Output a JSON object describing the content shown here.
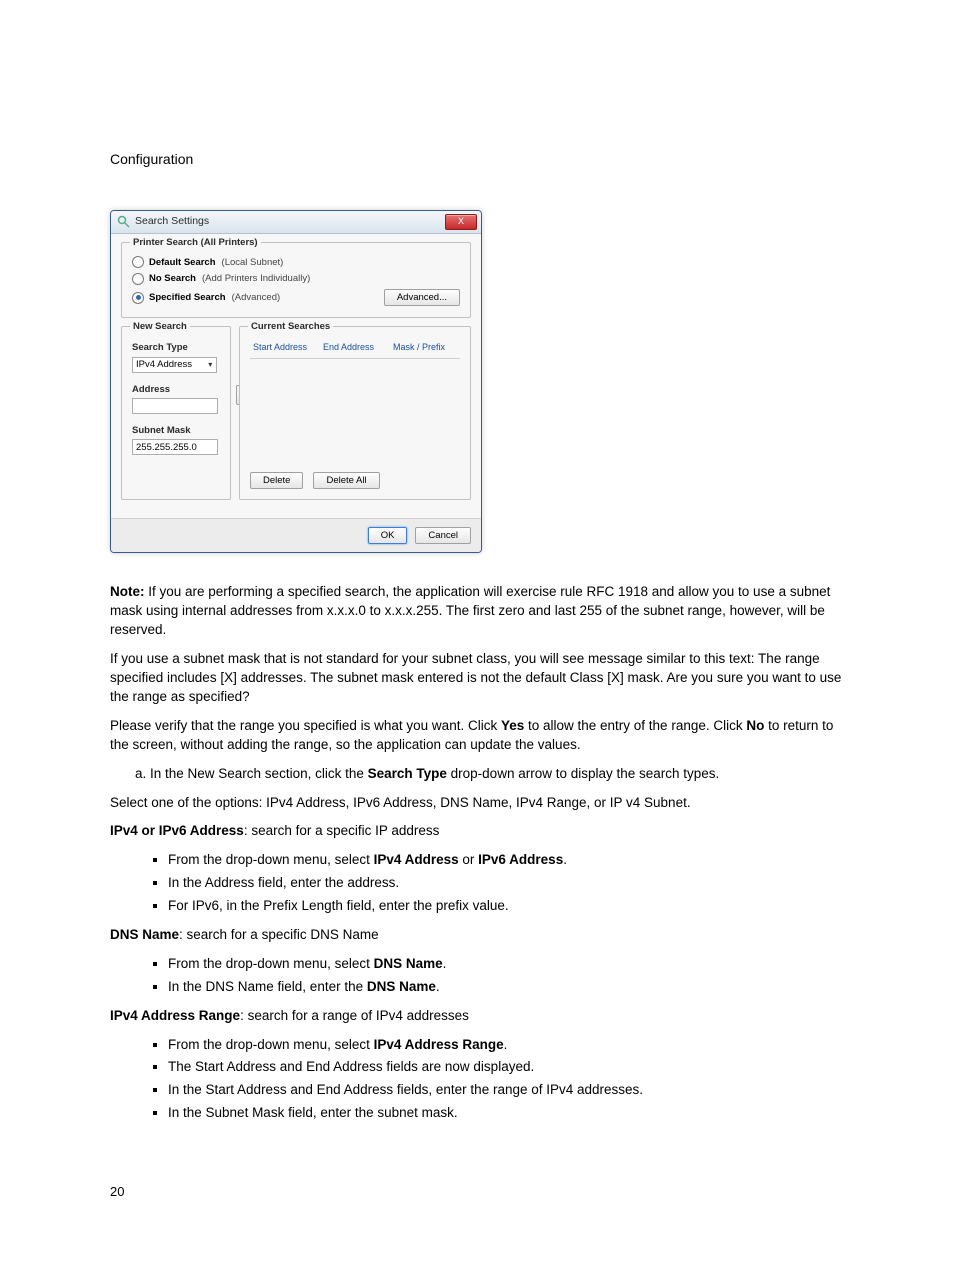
{
  "page": {
    "header": "Configuration",
    "number": "20"
  },
  "dialog": {
    "title": "Search Settings",
    "close": "X",
    "group_printer_search": {
      "legend": "Printer Search (All Printers)",
      "opt1": {
        "label": "Default Search",
        "hint": "(Local Subnet)"
      },
      "opt2": {
        "label": "No Search",
        "hint": "(Add Printers Individually)"
      },
      "opt3": {
        "label": "Specified Search",
        "hint": "(Advanced)"
      },
      "advanced_btn": "Advanced..."
    },
    "new_search": {
      "legend": "New Search",
      "search_type_label": "Search Type",
      "search_type_value": "IPv4 Address",
      "address_label": "Address",
      "address_value": "",
      "subnet_label": "Subnet Mask",
      "subnet_value": "255.255.255.0"
    },
    "current_searches": {
      "legend": "Current Searches",
      "col1": "Start Address",
      "col2": "End Address",
      "col3": "Mask / Prefix",
      "delete_btn": "Delete",
      "delete_all_btn": "Delete All"
    },
    "footer": {
      "ok": "OK",
      "cancel": "Cancel"
    }
  },
  "body": {
    "note_label": "Note:",
    "note_text": " If you are performing a specified search, the application will exercise rule RFC 1918 and allow you to use a subnet mask using internal addresses from x.x.x.0 to x.x.x.255. The first zero and last 255 of the subnet range, however, will be reserved.",
    "p2": "If you use a subnet mask that is not standard for your subnet class, you will see message similar to this text: The range specified includes [X] addresses. The subnet mask entered is not the default Class [X] mask. Are you sure you want to use the range as specified?",
    "p3_a": "Please verify that the range you specified is what you want. Click ",
    "p3_yes": "Yes",
    "p3_b": " to allow the entry of the range. Click ",
    "p3_no": "No",
    "p3_c": " to return to the screen, without adding the range, so the application can update the values.",
    "ol_a_pre": "In the New Search section, click the ",
    "ol_a_bold": "Search Type",
    "ol_a_post": " drop-down arrow to display the search types.",
    "p4": "Select one of the options: IPv4 Address, IPv6 Address, DNS Name, IPv4 Range, or IP v4 Subnet.",
    "s1": {
      "title": "IPv4 or IPv6 Address",
      "desc": ": search for a specific IP address",
      "li1_a": "From the drop-down menu, select ",
      "li1_b1": "IPv4 Address",
      "li1_mid": " or ",
      "li1_b2": "IPv6 Address",
      "li1_end": ".",
      "li2": "In the Address field, enter the address.",
      "li3": "For IPv6, in the Prefix Length field, enter the prefix value."
    },
    "s2": {
      "title": "DNS Name",
      "desc": ": search for a specific DNS Name",
      "li1_a": "From the drop-down menu, select ",
      "li1_b": "DNS Name",
      "li1_end": ".",
      "li2_a": "In the DNS Name field, enter the ",
      "li2_b": "DNS Name",
      "li2_end": "."
    },
    "s3": {
      "title": "IPv4 Address Range",
      "desc": ": search for a range of IPv4 addresses",
      "li1_a": "From the drop-down menu, select ",
      "li1_b": "IPv4 Address Range",
      "li1_end": ".",
      "li2": "The Start Address and End Address fields are now displayed.",
      "li3": "In the Start Address and End Address fields, enter the range of IPv4 addresses.",
      "li4": "In the Subnet Mask field, enter the subnet mask."
    }
  }
}
